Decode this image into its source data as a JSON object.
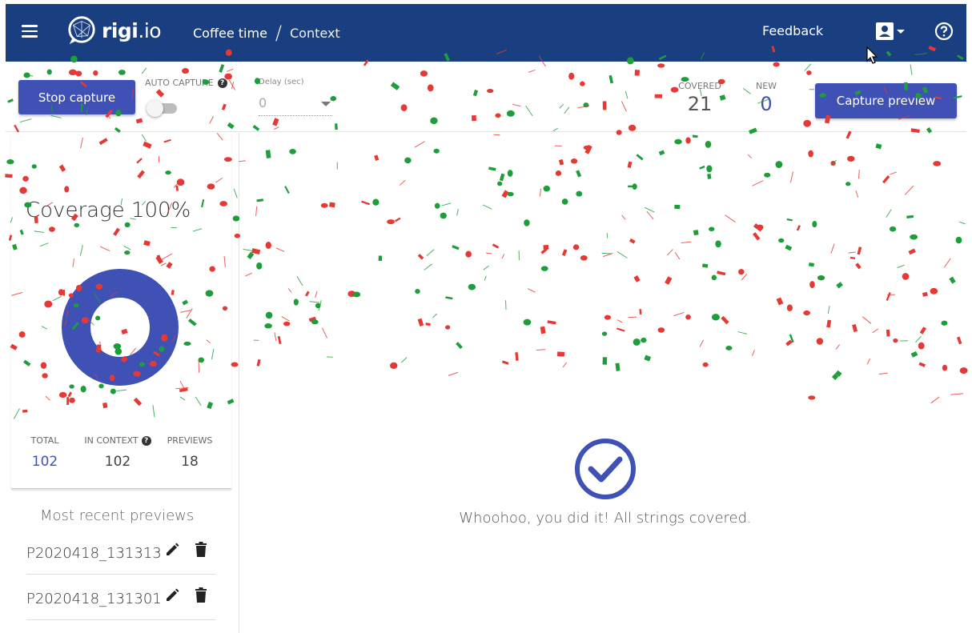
{
  "header": {
    "logo_bold": "rigi",
    "logo_light": ".io",
    "crumb_project": "Coffee time",
    "crumb_separator": "/",
    "crumb_page": "Context",
    "feedback_label": "Feedback",
    "icons": [
      "menu-icon",
      "account-icon",
      "help-icon"
    ]
  },
  "toolbar": {
    "stop_capture_label": "Stop capture",
    "auto_capture_label": "AUTO CAPTURE",
    "auto_capture_on": false,
    "delay_label": "Delay (sec)",
    "delay_value": "0",
    "covered_label": "COVERED",
    "covered_value": "21",
    "new_label": "NEW",
    "new_value": "0",
    "capture_preview_label": "Capture preview"
  },
  "sidebar": {
    "coverage_title": "Coverage 100%",
    "coverage_fraction": 1.0,
    "stats": {
      "total_label": "TOTAL",
      "total_value": "102",
      "in_context_label": "IN CONTEXT",
      "in_context_value": "102",
      "previews_label": "PREVIEWS",
      "previews_value": "18"
    },
    "recent_title": "Most recent previews",
    "previews": [
      {
        "name": "P2020418_131313"
      },
      {
        "name": "P2020418_131301"
      }
    ]
  },
  "main": {
    "message": "Whoohoo, you did it! All strings covered."
  },
  "colors": {
    "header_bg": "#1a3f80",
    "accent": "#3f51b5",
    "confetti_red": "#e53935",
    "confetti_green": "#1e9e3a"
  }
}
